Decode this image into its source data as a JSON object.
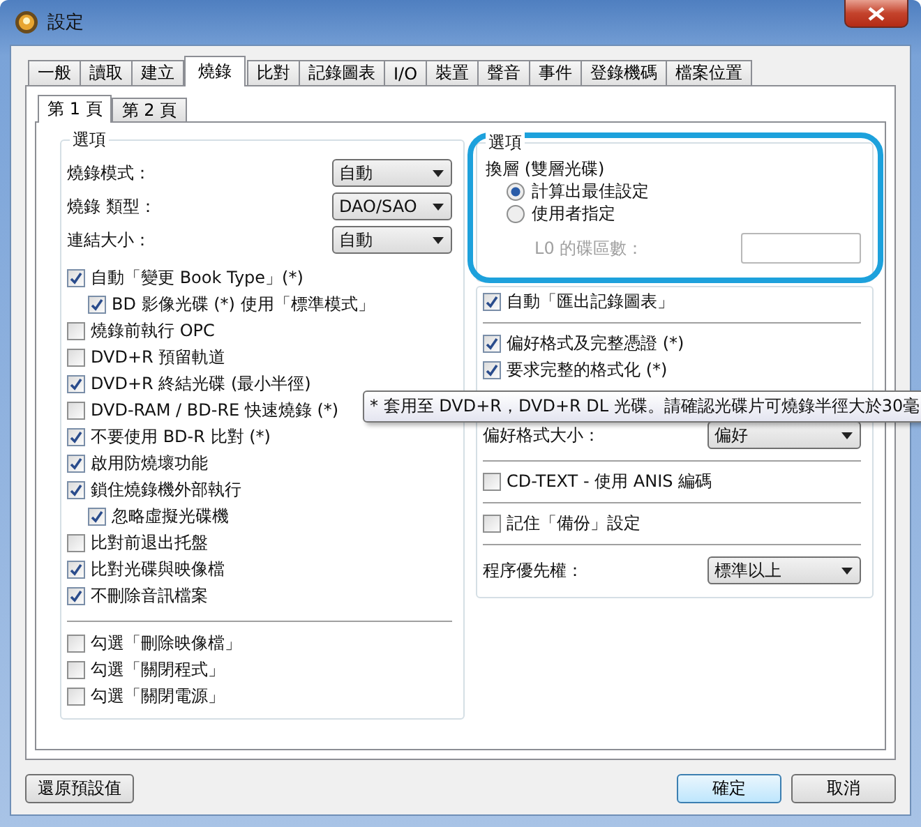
{
  "window": {
    "title": "設定"
  },
  "tabs": [
    {
      "label": "一般",
      "selected": false
    },
    {
      "label": "讀取",
      "selected": false
    },
    {
      "label": "建立",
      "selected": false
    },
    {
      "label": "燒錄",
      "selected": true
    },
    {
      "label": "比對",
      "selected": false
    },
    {
      "label": "記錄圖表",
      "selected": false
    },
    {
      "label": "I/O",
      "selected": false
    },
    {
      "label": "裝置",
      "selected": false
    },
    {
      "label": "聲音",
      "selected": false
    },
    {
      "label": "事件",
      "selected": false
    },
    {
      "label": "登錄機碼",
      "selected": false
    },
    {
      "label": "檔案位置",
      "selected": false
    }
  ],
  "subtabs": [
    {
      "label": "第 1 頁",
      "selected": true
    },
    {
      "label": "第 2 頁",
      "selected": false
    }
  ],
  "options_group": {
    "title": "選項",
    "dropdowns": [
      {
        "label": "燒錄模式：",
        "value": "自動"
      },
      {
        "label": "燒錄 類型：",
        "value": "DAO/SAO"
      },
      {
        "label": "連結大小：",
        "value": "自動"
      }
    ],
    "checkboxes": [
      {
        "label": "自動「變更 Book Type」(*)",
        "checked": true,
        "children": [
          {
            "label": "BD 影像光碟  (*) 使用「標準模式」",
            "checked": true
          }
        ]
      },
      {
        "label": "燒錄前執行 OPC",
        "checked": false
      },
      {
        "label": "DVD+R 預留軌道",
        "checked": false
      },
      {
        "label": "DVD+R 終結光碟 (最小半徑)",
        "checked": true
      },
      {
        "label": "DVD-RAM / BD-RE 快速燒錄 (*)",
        "checked": false
      },
      {
        "label": "不要使用 BD-R 比對 (*)",
        "checked": true
      },
      {
        "label": "啟用防燒壞功能",
        "checked": true
      },
      {
        "label": "鎖住燒錄機外部執行",
        "checked": true,
        "children": [
          {
            "label": "忽略虛擬光碟機",
            "checked": true
          }
        ]
      },
      {
        "label": "比對前退出托盤",
        "checked": false
      },
      {
        "label": "比對光碟與映像檔",
        "checked": true
      },
      {
        "label": "不刪除音訊檔案",
        "checked": true
      }
    ],
    "after_checkboxes": [
      {
        "label": "勾選「刪除映像檔」",
        "checked": false
      },
      {
        "label": "勾選「關閉程式」",
        "checked": false
      },
      {
        "label": "勾選「關閉電源」",
        "checked": false
      }
    ]
  },
  "layer_group": {
    "title": "選項",
    "label": "換層 (雙層光碟)",
    "highlighted": true,
    "radios": [
      {
        "label": "計算出最佳設定",
        "selected": true
      },
      {
        "label": "使用者指定",
        "selected": false
      }
    ],
    "sectors_field": {
      "label": "L0 的碟區數：",
      "disabled": true
    }
  },
  "right_items": [
    {
      "kind": "checkbox",
      "label": "自動「匯出記錄圖表」",
      "checked": true
    },
    {
      "kind": "divider"
    },
    {
      "kind": "checkbox",
      "label": "偏好格式及完整憑證 (*)",
      "checked": true
    },
    {
      "kind": "checkbox",
      "label": "要求完整的格式化 (*)",
      "checked": true
    },
    {
      "kind": "gap"
    },
    {
      "kind": "dropdown",
      "label": "偏好格式大小：",
      "value": "偏好"
    },
    {
      "kind": "divider"
    },
    {
      "kind": "checkbox",
      "label": "CD-TEXT - 使用 ANIS 編碼",
      "checked": false
    },
    {
      "kind": "divider"
    },
    {
      "kind": "checkbox",
      "label": "記住「備份」設定",
      "checked": false
    },
    {
      "kind": "divider"
    },
    {
      "kind": "dropdown",
      "label": "程序優先權：",
      "value": "標準以上"
    }
  ],
  "tooltip": "* 套用至 DVD+R，DVD+R DL 光碟。請確認光碟片可燒錄半徑大於30毫",
  "buttons": [
    {
      "label": "還原預設值",
      "kind": "left"
    },
    {
      "label": "確定",
      "kind": "default"
    },
    {
      "label": "取消",
      "kind": "normal"
    }
  ]
}
